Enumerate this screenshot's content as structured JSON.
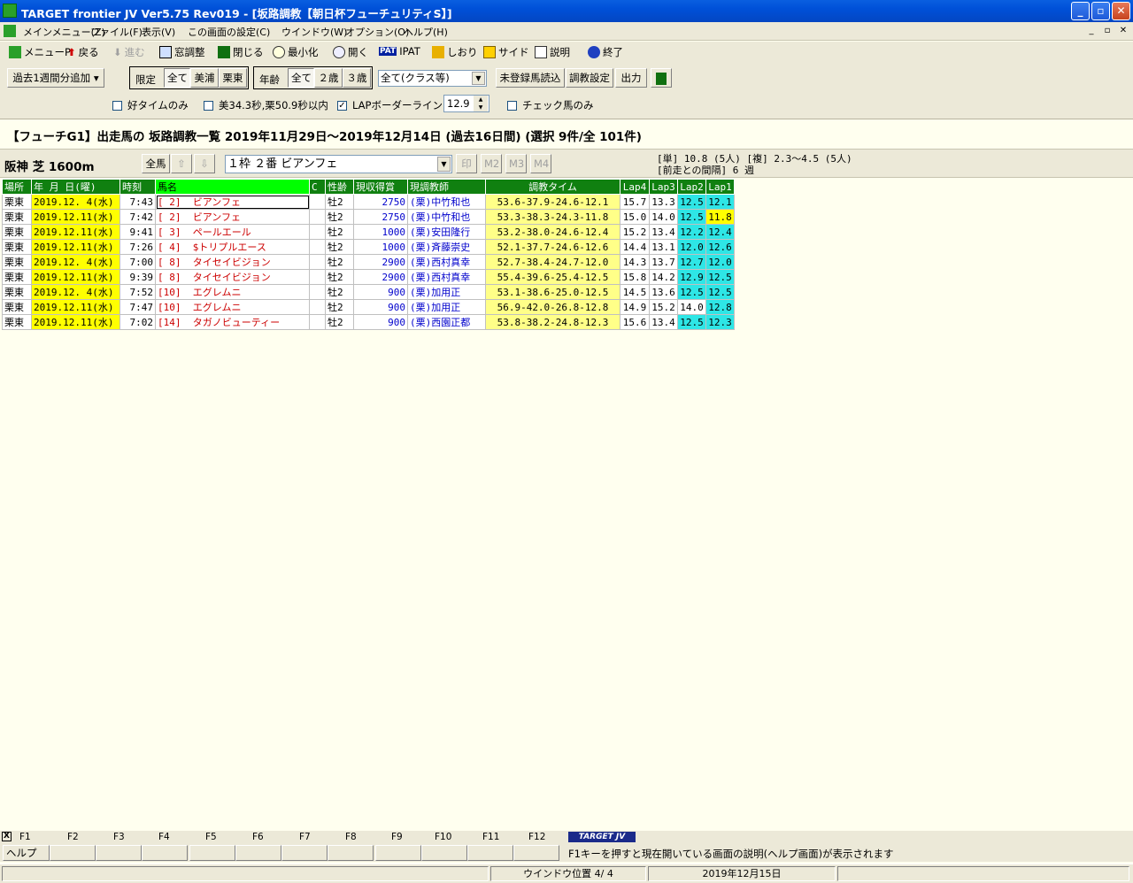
{
  "window": {
    "title": "TARGET frontier JV  Ver5.75  Rev019 - [坂路調教【朝日杯フューチュリティS】]"
  },
  "menu": {
    "items": [
      "メインメニュー(Z)",
      "ファイル(F)",
      "表示(V)",
      "この画面の設定(C)",
      "ウインドウ(W)",
      "オプション(O)",
      "ヘルプ(H)"
    ]
  },
  "toolbar": {
    "menu": "メニューP",
    "back": "戻る",
    "forward": "進む",
    "window_adjust": "窓調整",
    "close": "閉じる",
    "minimize": "最小化",
    "open": "開く",
    "ipat": "IPAT",
    "bookmark": "しおり",
    "side": "サイド",
    "help": "説明",
    "exit": "終了",
    "pat_badge": "PAT"
  },
  "filters": {
    "add_week": "過去1週間分追加",
    "limit_label": "限定",
    "limit_all": "全て",
    "limit_miho": "美浦",
    "limit_ritto": "栗東",
    "age_label": "年齢",
    "age_all": "全て",
    "age_2": "２歳",
    "age_3": "３歳",
    "class_select": "全て(クラス等)",
    "unregistered": "未登録馬読込",
    "chokyo_settings": "調教設定",
    "output": "出力",
    "good_time_only": "好タイムのみ",
    "time_cond": "美34.3秒,栗50.9秒以内",
    "lap_border": "LAPボーダーライン",
    "lap_border_value": "12.9",
    "check_horse_only": "チェック馬のみ"
  },
  "heading": "【フューチG1】出走馬の 坂路調教一覧  2019年11月29日～2019年12月14日 (過去16日間)  (選択 9件/全 101件)",
  "race": {
    "course": "阪神 芝 1600m",
    "all_horses": "全馬",
    "horse_select": "１枠  ２番  ビアンフェ",
    "mark_print": "印",
    "m2": "M2",
    "m3": "M3",
    "m4": "M4",
    "odds_line1": "[単]  10.8 (5人) [複] 2.3～4.5 (5人)",
    "odds_line2": "[前走との間隔] 6 週"
  },
  "table": {
    "headers": [
      "場所",
      "年  月 日(曜)",
      "時刻",
      "馬名",
      "C",
      "性齢",
      "現収得賞",
      "現調教師",
      "調教タイム",
      "Lap4",
      "Lap3",
      "Lap2",
      "Lap1"
    ],
    "rows": [
      {
        "place": "栗東",
        "date": "2019.12. 4(水)",
        "time": "7:43",
        "waku": "[ 2]",
        "horse": "ビアンフェ",
        "c": "",
        "sex": "牡2",
        "prize": "2750",
        "trainer": "(栗)中竹和也",
        "chokyo": "53.6-37.9-24.6-12.1",
        "lap4": "15.7",
        "lap3": "13.3",
        "lap2": "12.5",
        "lap1": "12.1"
      },
      {
        "place": "栗東",
        "date": "2019.12.11(水)",
        "time": "7:42",
        "waku": "[ 2]",
        "horse": "ビアンフェ",
        "c": "",
        "sex": "牡2",
        "prize": "2750",
        "trainer": "(栗)中竹和也",
        "chokyo": "53.3-38.3-24.3-11.8",
        "lap4": "15.0",
        "lap3": "14.0",
        "lap2": "12.5",
        "lap1": "11.8"
      },
      {
        "place": "栗東",
        "date": "2019.12.11(水)",
        "time": "9:41",
        "waku": "[ 3]",
        "horse": "ペールエール",
        "c": "",
        "sex": "牡2",
        "prize": "1000",
        "trainer": "(栗)安田隆行",
        "chokyo": "53.2-38.0-24.6-12.4",
        "lap4": "15.2",
        "lap3": "13.4",
        "lap2": "12.2",
        "lap1": "12.4"
      },
      {
        "place": "栗東",
        "date": "2019.12.11(水)",
        "time": "7:26",
        "waku": "[ 4]",
        "horse": "$トリプルエース",
        "c": "",
        "sex": "牡2",
        "prize": "1000",
        "trainer": "(栗)斉藤崇史",
        "chokyo": "52.1-37.7-24.6-12.6",
        "lap4": "14.4",
        "lap3": "13.1",
        "lap2": "12.0",
        "lap1": "12.6"
      },
      {
        "place": "栗東",
        "date": "2019.12. 4(水)",
        "time": "7:00",
        "waku": "[ 8]",
        "horse": "タイセイビジョン",
        "c": "",
        "sex": "牡2",
        "prize": "2900",
        "trainer": "(栗)西村真幸",
        "chokyo": "52.7-38.4-24.7-12.0",
        "lap4": "14.3",
        "lap3": "13.7",
        "lap2": "12.7",
        "lap1": "12.0"
      },
      {
        "place": "栗東",
        "date": "2019.12.11(水)",
        "time": "9:39",
        "waku": "[ 8]",
        "horse": "タイセイビジョン",
        "c": "",
        "sex": "牡2",
        "prize": "2900",
        "trainer": "(栗)西村真幸",
        "chokyo": "55.4-39.6-25.4-12.5",
        "lap4": "15.8",
        "lap3": "14.2",
        "lap2": "12.9",
        "lap1": "12.5"
      },
      {
        "place": "栗東",
        "date": "2019.12. 4(水)",
        "time": "7:52",
        "waku": "[10]",
        "horse": "エグレムニ",
        "c": "",
        "sex": "牡2",
        "prize": "900",
        "trainer": "(栗)加用正",
        "chokyo": "53.1-38.6-25.0-12.5",
        "lap4": "14.5",
        "lap3": "13.6",
        "lap2": "12.5",
        "lap1": "12.5"
      },
      {
        "place": "栗東",
        "date": "2019.12.11(水)",
        "time": "7:47",
        "waku": "[10]",
        "horse": "エグレムニ",
        "c": "",
        "sex": "牡2",
        "prize": "900",
        "trainer": "(栗)加用正",
        "chokyo": "56.9-42.0-26.8-12.8",
        "lap4": "14.9",
        "lap3": "15.2",
        "lap2": "14.0",
        "lap1": "12.8"
      },
      {
        "place": "栗東",
        "date": "2019.12.11(水)",
        "time": "7:02",
        "waku": "[14]",
        "horse": "タガノビューティー",
        "c": "",
        "sex": "牡2",
        "prize": "900",
        "trainer": "(栗)西園正都",
        "chokyo": "53.8-38.2-24.8-12.3",
        "lap4": "15.6",
        "lap3": "13.4",
        "lap2": "12.5",
        "lap1": "12.3"
      }
    ]
  },
  "fkeys": {
    "x_mark": "X",
    "labels": [
      "F1",
      "F2",
      "F3",
      "F4",
      "F5",
      "F6",
      "F7",
      "F8",
      "F9",
      "F10",
      "F11",
      "F12"
    ],
    "f1_button": "ヘルプ",
    "logo": "TARGET JV",
    "hint": "F1キーを押すと現在開いている画面の説明(ヘルプ画面)が表示されます"
  },
  "status": {
    "window_pos": "ウインドウ位置 4/ 4",
    "date": "2019年12月15日"
  }
}
